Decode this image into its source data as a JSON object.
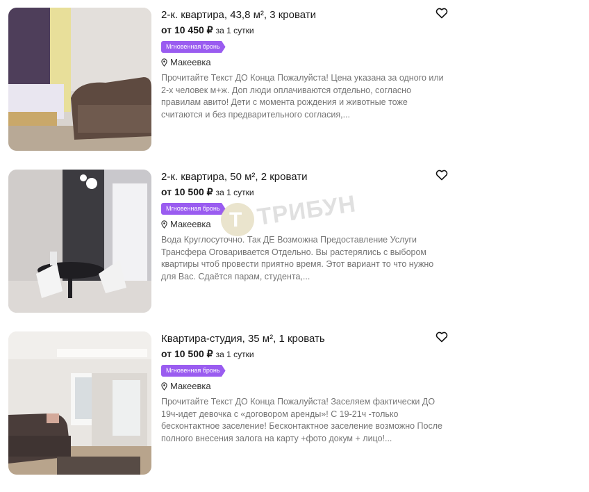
{
  "listings": [
    {
      "title": "2-к. квартира, 43,8 м², 3 кровати",
      "price": "от 10 450 ₽",
      "per": "за 1 сутки",
      "badge": "Мгновенная бронь",
      "location": "Макеевка",
      "description": "Прочитайте Текст ДО Конца Пожалуйста! Цена указана за одного или 2-х человек м+ж. Доп люди оплачиваются отдельно, согласно правилам авито! Дети с момента рождения и животные тоже считаются и без предварительного согласия,..."
    },
    {
      "title": "2-к. квартира, 50 м², 2 кровати",
      "price": "от 10 500 ₽",
      "per": "за 1 сутки",
      "badge": "Мгновенная бронь",
      "location": "Макеевка",
      "description": "Вода Круглосуточно. Так ДЕ Возможна Предоставление Услуги Трансфера Оговаривается Отдельно. Вы растерялись с выбором квартиры чтоб провести приятно время. Этот вариант то что нужно для Вас. Сдаётся парам, студента,..."
    },
    {
      "title": "Квартира-студия, 35 м², 1 кровать",
      "price": "от 10 500 ₽",
      "per": "за 1 сутки",
      "badge": "Мгновенная бронь",
      "location": "Макеевка",
      "description": "Прочитайте Текст ДО Конца Пожалуйста! Заселяем фактически ДО 19ч-идет девочка с «договором аренды»! С 19-21ч -только бесконтактное заселение! Бесконтактное заселение возможно После полного внесения залога на карту +фото докум + лицо!..."
    }
  ],
  "watermark": "ТРИБУН",
  "colors": {
    "badge": "#9a5cf0",
    "description": "#757575"
  }
}
